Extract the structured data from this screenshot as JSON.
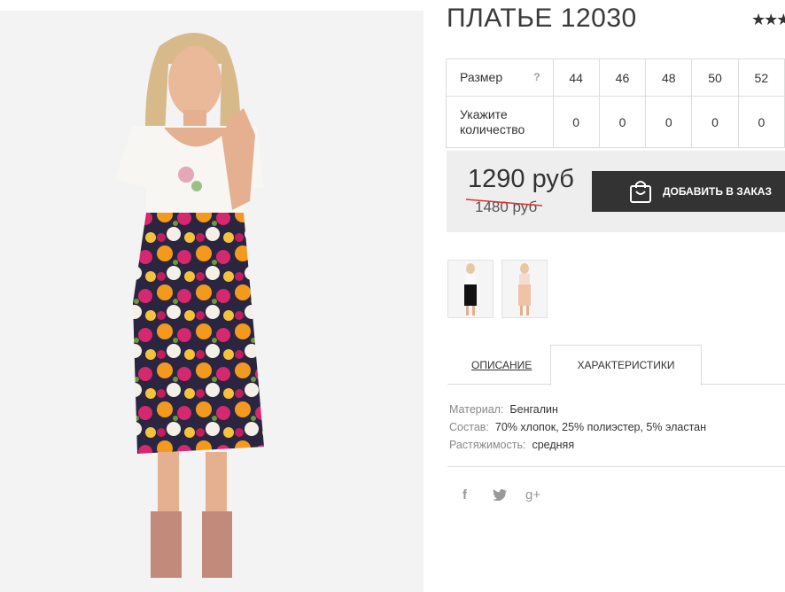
{
  "product": {
    "title": "ПЛАТЬЕ 12030",
    "rating_stars": "★★★",
    "sizes_table": {
      "size_label": "Размер",
      "help_mark": "?",
      "sizes": [
        "44",
        "46",
        "48",
        "50",
        "52"
      ],
      "qty_label": "Укажите количество",
      "quantities": [
        "0",
        "0",
        "0",
        "0",
        "0"
      ]
    },
    "price": "1290 руб",
    "old_price": "1480 руб",
    "order_button": "ДОБАВИТЬ В ЗАКАЗ"
  },
  "tabs": [
    {
      "label": "ОПИСАНИЕ",
      "active": false
    },
    {
      "label": "ХАРАКТЕРИСТИКИ",
      "active": true
    }
  ],
  "specs": [
    {
      "key": "Материал:",
      "value": "Бенгалин"
    },
    {
      "key": "Состав:",
      "value": "70% хлопок, 25% полиэстер, 5% эластан"
    },
    {
      "key": "Растяжимость:",
      "value": "средняя"
    }
  ],
  "social": [
    "f",
    "t",
    "g+"
  ],
  "colors": {
    "accent_dark": "#333333",
    "price_bg": "#eeeeee",
    "strike": "#e03030"
  }
}
